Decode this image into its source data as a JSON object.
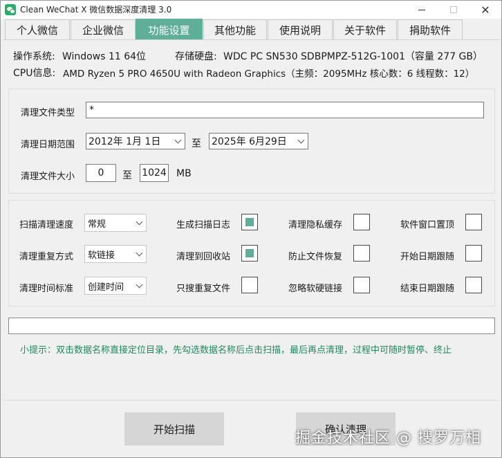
{
  "window": {
    "title": "Clean WeChat X 微信数据深度清理 3.0",
    "minimize": "—",
    "close": "✕"
  },
  "tabs": [
    {
      "label": "个人微信",
      "active": false
    },
    {
      "label": "企业微信",
      "active": false
    },
    {
      "label": "功能设置",
      "active": true
    },
    {
      "label": "其他功能",
      "active": false
    },
    {
      "label": "使用说明",
      "active": false
    },
    {
      "label": "关于软件",
      "active": false
    },
    {
      "label": "捐助软件",
      "active": false
    }
  ],
  "system": {
    "os_label": "操作系统:",
    "os_value": "Windows 11 64位",
    "disk_label": "存储硬盘:",
    "disk_value": "WDC PC SN530 SDBPMPZ-512G-1001（容量 277 GB）",
    "cpu_label": "CPU信息:",
    "cpu_value": "AMD Ryzen 5 PRO 4650U with Radeon Graphics（主频：2095MHz  核心数：6  线程数：12）"
  },
  "filters": {
    "file_type_label": "清理文件类型",
    "file_type_value": "*",
    "date_range_label": "清理日期范围",
    "date_start": "2012年  1月  1日",
    "date_to": "至",
    "date_end": "2025年  6月29日",
    "size_label": "清理文件大小",
    "size_min": "0",
    "size_to": "至",
    "size_max": "1024",
    "size_unit": "MB"
  },
  "options": {
    "scan_speed_label": "扫描清理速度",
    "scan_speed_value": "常规",
    "dup_mode_label": "清理重复方式",
    "dup_mode_value": "软链接",
    "time_std_label": "清理时间标准",
    "time_std_value": "创建时间",
    "checks": [
      {
        "label": "生成扫描日志",
        "checked": true
      },
      {
        "label": "清理隐私缓存",
        "checked": false
      },
      {
        "label": "软件窗口置顶",
        "checked": false
      },
      {
        "label": "清理到回收站",
        "checked": true
      },
      {
        "label": "防止文件恢复",
        "checked": false
      },
      {
        "label": "开始日期跟随",
        "checked": false
      },
      {
        "label": "只搜重复文件",
        "checked": false
      },
      {
        "label": "忽略软硬链接",
        "checked": false
      },
      {
        "label": "结束日期跟随",
        "checked": false
      }
    ]
  },
  "progress": {
    "value": 0
  },
  "tip": "小提示：双击数据名称直接定位目录，先勾选数据名称后点击扫描，最后再点清理，过程中可随时暂停、终止",
  "buttons": {
    "start_scan": "开始扫描",
    "confirm_clean": "确认清理"
  },
  "watermark": "掘金技术社区 @ 搜罗万相",
  "colors": {
    "accent": "#5faf98",
    "tip": "#1e8a5e"
  }
}
